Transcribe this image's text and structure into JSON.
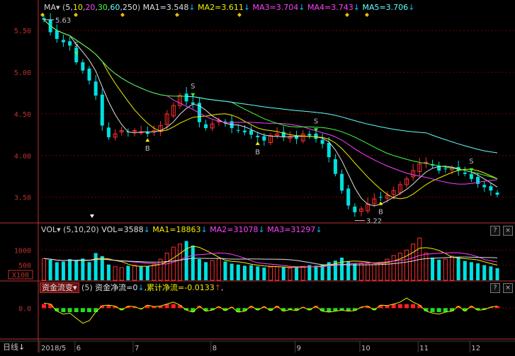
{
  "price_header": {
    "ma_label": "MA",
    "params_open": "(",
    "params": [
      "5",
      "10",
      "20",
      "30",
      "60",
      "250"
    ],
    "params_close": ")",
    "ma1": "MA1=3.548",
    "ma2": "MA2=3.611",
    "ma3": "MA3=3.704",
    "ma4": "MA4=3.743",
    "ma5": "MA5=3.706",
    "arrow": "↓"
  },
  "vol_header": {
    "label": "VOL",
    "params": "(5,10,20)",
    "vol": "VOL=3588",
    "ma1": "MA1=18863",
    "ma2": "MA2=31078",
    "ma3": "MA3=31297",
    "arrow": "↓"
  },
  "flow_header": {
    "dropdown": "资金流变",
    "param": "(5)",
    "net": "资金净流=0",
    "net_arrow": "↓",
    "cum": ",累计净流=-0.0133",
    "cum_arrow": "↑",
    "tail": ","
  },
  "bottom_bar": {
    "period": "日线",
    "period_arrow": "↓"
  },
  "colors": {
    "up": "#ff3030",
    "down": "#00e0e0",
    "ma5": "#e0e0e0",
    "ma10": "#f0f000",
    "ma20": "#ff40ff",
    "ma30": "#40ff40",
    "ma60": "#60ffff",
    "axis": "#c03030",
    "grid": "#7a0000",
    "volume_label": "#c03030"
  },
  "chart_data": [
    {
      "type": "candlestick",
      "title": "MA",
      "yticks": [
        5.5,
        5.0,
        4.5,
        4.0,
        3.5
      ],
      "ylim": [
        3.2,
        5.68
      ],
      "x_labels": [
        "2018/5",
        "6",
        "7",
        "8",
        "9",
        "10",
        "11",
        "12"
      ],
      "annotations": {
        "high_label": "5.63",
        "low_label": "3.22",
        "buy_marker": "B",
        "sell_marker": "S"
      },
      "signals": [
        {
          "type": "S",
          "index": 5
        },
        {
          "type": "B",
          "index": 16
        },
        {
          "type": "S",
          "index": 23
        },
        {
          "type": "B",
          "index": 33
        },
        {
          "type": "S",
          "index": 42
        },
        {
          "type": "B",
          "index": 52
        },
        {
          "type": "S",
          "index": 66
        }
      ],
      "closes": [
        5.63,
        5.48,
        5.4,
        5.36,
        5.32,
        5.12,
        5.02,
        4.9,
        4.72,
        4.36,
        4.22,
        4.26,
        4.3,
        4.28,
        4.3,
        4.28,
        4.26,
        4.3,
        4.36,
        4.5,
        4.6,
        4.72,
        4.65,
        4.62,
        4.4,
        4.33,
        4.38,
        4.42,
        4.4,
        4.33,
        4.3,
        4.28,
        4.25,
        4.22,
        4.18,
        4.24,
        4.26,
        4.22,
        4.23,
        4.2,
        4.26,
        4.24,
        4.2,
        4.14,
        3.98,
        3.78,
        3.58,
        3.4,
        3.32,
        3.36,
        3.42,
        3.48,
        3.5,
        3.52,
        3.58,
        3.65,
        3.72,
        3.82,
        3.9,
        3.92,
        3.88,
        3.82,
        3.84,
        3.85,
        3.82,
        3.78,
        3.72,
        3.66,
        3.62,
        3.58,
        3.53
      ],
      "series_names": [
        "MA5",
        "MA10",
        "MA20",
        "MA30",
        "MA60"
      ]
    },
    {
      "type": "bar",
      "title": "VOL",
      "yticks": [
        1000,
        500
      ],
      "unit_label": "X100",
      "volumes": [
        720,
        680,
        600,
        620,
        700,
        650,
        720,
        600,
        900,
        800,
        520,
        450,
        420,
        480,
        500,
        460,
        470,
        520,
        700,
        900,
        1100,
        1200,
        1300,
        1150,
        700,
        600,
        650,
        720,
        620,
        550,
        520,
        480,
        500,
        460,
        420,
        440,
        450,
        430,
        400,
        420,
        460,
        500,
        480,
        520,
        600,
        650,
        750,
        620,
        560,
        550,
        560,
        520,
        600,
        700,
        820,
        900,
        1000,
        1200,
        1400,
        900,
        750,
        680,
        700,
        800,
        760,
        640,
        600,
        560,
        500,
        460,
        400
      ],
      "ylim": [
        0,
        1500
      ]
    },
    {
      "type": "bar",
      "title": "资金流变",
      "yticks": [
        0.0
      ],
      "ylim": [
        -0.06,
        0.03
      ],
      "flow": [
        0.01,
        0.008,
        -0.006,
        -0.012,
        -0.01,
        -0.02,
        -0.03,
        -0.025,
        -0.008,
        0.005,
        0.006,
        0.004,
        -0.004,
        0.004,
        0.003,
        -0.002,
        0.006,
        0.003,
        0.004,
        0.008,
        0.012,
        0.006,
        -0.004,
        -0.008,
        0.004,
        -0.006,
        -0.004,
        0.003,
        -0.005,
        0.002,
        -0.008,
        -0.006,
        0.004,
        -0.004,
        0.003,
        -0.005,
        0.004,
        -0.006,
        -0.003,
        -0.005,
        0.002,
        -0.004,
        0.004,
        -0.006,
        -0.008,
        -0.006,
        -0.004,
        -0.006,
        -0.005,
        0.002,
        0.004,
        -0.004,
        0.006,
        0.005,
        0.008,
        0.012,
        0.02,
        0.012,
        0.006,
        -0.006,
        -0.01,
        -0.012,
        -0.008,
        -0.006,
        0.004,
        -0.006,
        0.004,
        -0.004,
        -0.003,
        0.002,
        0.004
      ]
    }
  ]
}
